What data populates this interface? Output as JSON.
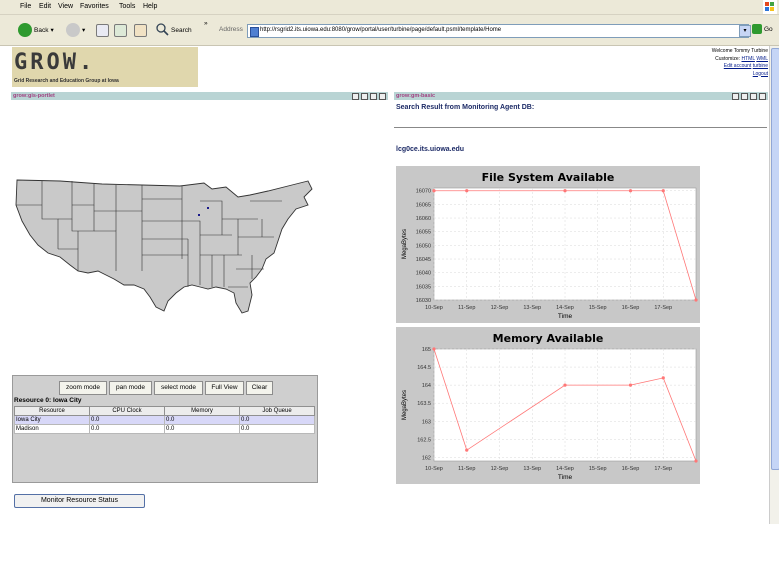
{
  "menubar": {
    "items": [
      "File",
      "Edit",
      "View",
      "Favorites",
      "Tools",
      "Help"
    ]
  },
  "toolbar": {
    "back_label": "Back",
    "search_label": "Search",
    "more_label": "»",
    "address_label": "Address",
    "url": "http://rsgrid2.its.uiowa.edu:8080/grow/portal/user/turbine/page/default.psml/template/Home",
    "dropdown_glyph": "▾",
    "go_label": "Go"
  },
  "header": {
    "logo_text": "GROW.",
    "logo_subtitle": "Grid Research and Education Group at Iowa",
    "welcome": "Welcome Tommy Turbine",
    "customize_label": "Customize:",
    "html_link": "HTML",
    "wml_link": "WML",
    "edit_account": "Edit account",
    "turbine": "turbine",
    "logout": "Logout"
  },
  "left_portlet": {
    "title": "grow:gis-portlet",
    "buttons": [
      "zoom mode",
      "pan mode",
      "select mode",
      "Full View",
      "Clear"
    ],
    "resource_title": "Resource 0: Iowa City",
    "columns": [
      "Resource",
      "CPU Clock",
      "Memory",
      "Job Queue"
    ],
    "rows": [
      {
        "resource": "Iowa City",
        "cpu": "0.0",
        "memory": "0.0",
        "jobs": "0.0"
      },
      {
        "resource": "Madison",
        "cpu": "0.0",
        "memory": "0.0",
        "jobs": "0.0"
      }
    ],
    "monitor_button": "Monitor Resource Status"
  },
  "right_portlet": {
    "title": "grow:gm-basic",
    "search_result": "Search Result from Monitoring Agent DB:",
    "hostname": "lcg0ce.its.uiowa.edu"
  },
  "chart_data": [
    {
      "type": "line",
      "title": "File System Available",
      "xlabel": "Time",
      "ylabel": "MegaBytes",
      "x": [
        "10-Sep",
        "11-Sep",
        "12-Sep",
        "13-Sep",
        "14-Sep",
        "15-Sep",
        "16-Sep",
        "17-Sep"
      ],
      "series": [
        {
          "x": [
            10,
            11,
            14,
            16,
            17,
            18
          ],
          "values": [
            16070,
            16070,
            16070,
            16070,
            16070,
            16030
          ]
        }
      ],
      "ylim": [
        16030,
        16071
      ],
      "yticks": [
        16030,
        16035,
        16040,
        16045,
        16050,
        16055,
        16060,
        16065,
        16070
      ],
      "color": "#ff7777",
      "grid": true
    },
    {
      "type": "line",
      "title": "Memory Available",
      "xlabel": "Time",
      "ylabel": "MegaBytes",
      "x": [
        "10-Sep",
        "11-Sep",
        "12-Sep",
        "13-Sep",
        "14-Sep",
        "15-Sep",
        "16-Sep",
        "17-Sep"
      ],
      "series": [
        {
          "x": [
            10,
            11,
            14,
            16,
            17,
            18
          ],
          "values": [
            165.0,
            162.2,
            164.0,
            164.0,
            164.2,
            161.9
          ]
        }
      ],
      "ylim": [
        161.9,
        165.0
      ],
      "yticks": [
        162.0,
        162.5,
        163.0,
        163.5,
        164.0,
        164.5,
        165.0
      ],
      "color": "#ff7777",
      "grid": true
    }
  ]
}
